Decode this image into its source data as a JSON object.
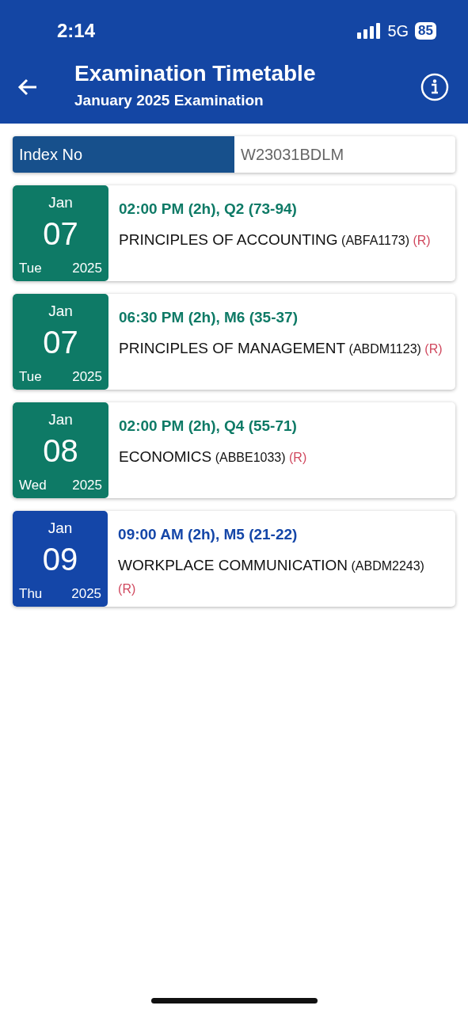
{
  "status_bar": {
    "time": "2:14",
    "network": "5G",
    "battery": "85"
  },
  "header": {
    "title": "Examination Timetable",
    "subtitle": "January 2025 Examination"
  },
  "index": {
    "label": "Index No",
    "value": "W23031BDLM"
  },
  "exams": [
    {
      "month": "Jan",
      "day": "07",
      "weekday": "Tue",
      "year": "2025",
      "color": "#0e7a66",
      "time": "02:00 PM (2h), Q2 (73-94)",
      "subject": "PRINCIPLES OF ACCOUNTING",
      "code": "(ABFA1173)",
      "tag": "(R)"
    },
    {
      "month": "Jan",
      "day": "07",
      "weekday": "Tue",
      "year": "2025",
      "color": "#0e7a66",
      "time": "06:30 PM (2h), M6 (35-37)",
      "subject": "PRINCIPLES OF MANAGEMENT",
      "code": "(ABDM1123)",
      "tag": "(R)"
    },
    {
      "month": "Jan",
      "day": "08",
      "weekday": "Wed",
      "year": "2025",
      "color": "#0e7a66",
      "time": "02:00 PM (2h), Q4 (55-71)",
      "subject": "ECONOMICS",
      "code": "(ABBE1033)",
      "tag": "(R)"
    },
    {
      "month": "Jan",
      "day": "09",
      "weekday": "Thu",
      "year": "2025",
      "color": "#1446a8",
      "time": "09:00 AM (2h), M5 (21-22)",
      "subject": "WORKPLACE COMMUNICATION",
      "code": "(ABDM2243)",
      "tag": "(R)"
    }
  ]
}
